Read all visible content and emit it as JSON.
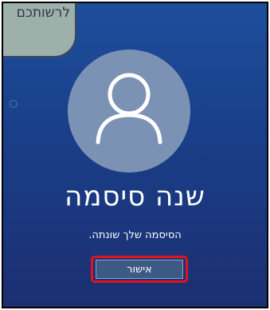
{
  "callout": {
    "text": "לרשותכם"
  },
  "screen": {
    "avatar_icon": "user-icon",
    "title": "שנה סיסמה",
    "message": "הסיסמה שלך שונתה.",
    "ok_label": "אישור"
  },
  "colors": {
    "background_top": "#1d4e9c",
    "background_bottom": "#1c2f72",
    "highlight": "#e2141b",
    "button": "#3c5a84"
  }
}
